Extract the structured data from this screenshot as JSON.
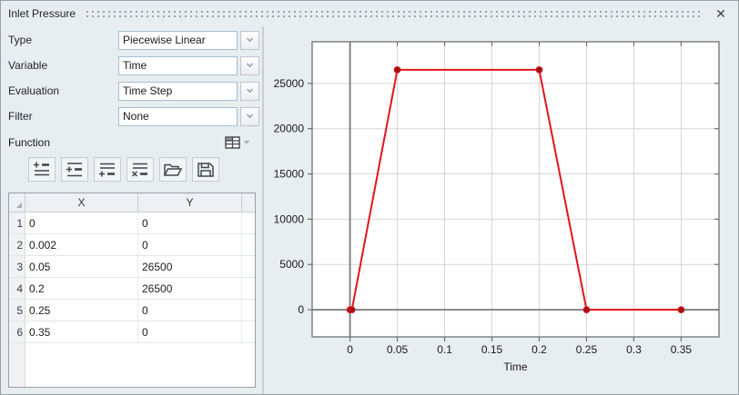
{
  "colors": {
    "panel_bg": "#e8edf0",
    "line_red": "#e1161d",
    "marker_red": "#9e1216",
    "grid_gray": "#d6d6d6",
    "plot_border": "#6e7275",
    "zero_axis": "#77797b"
  },
  "window": {
    "title": "Inlet Pressure",
    "close_glyph": "✕"
  },
  "form": {
    "fields": [
      {
        "label": "Type",
        "value": "Piecewise Linear"
      },
      {
        "label": "Variable",
        "value": "Time"
      },
      {
        "label": "Evaluation",
        "value": "Time Step"
      },
      {
        "label": "Filter",
        "value": "None"
      }
    ]
  },
  "function_section": {
    "label": "Function",
    "grid_menu_icon": "table-grid-icon",
    "toolbar_icons": [
      "insert-row-first-icon",
      "insert-row-above-icon",
      "append-row-icon",
      "delete-row-icon",
      "open-file-icon",
      "save-file-icon"
    ]
  },
  "table": {
    "columns": {
      "x": "X",
      "y": "Y"
    },
    "rows": [
      {
        "n": "1",
        "x": "0",
        "y": "0"
      },
      {
        "n": "2",
        "x": "0.002",
        "y": "0"
      },
      {
        "n": "3",
        "x": "0.05",
        "y": "26500"
      },
      {
        "n": "4",
        "x": "0.2",
        "y": "26500"
      },
      {
        "n": "5",
        "x": "0.25",
        "y": "0"
      },
      {
        "n": "6",
        "x": "0.35",
        "y": "0"
      }
    ]
  },
  "chart_data": {
    "type": "line",
    "title": "",
    "xlabel": "Time",
    "ylabel": "",
    "xlim": [
      -0.04,
      0.39
    ],
    "ylim": [
      -3000,
      29600
    ],
    "xticks": [
      0,
      0.05,
      0.1,
      0.15,
      0.2,
      0.25,
      0.3,
      0.35
    ],
    "xtick_labels": [
      "0",
      "0.05",
      "0.1",
      "0.15",
      "0.2",
      "0.25",
      "0.3",
      "0.35"
    ],
    "yticks": [
      0,
      5000,
      10000,
      15000,
      20000,
      25000
    ],
    "ytick_labels": [
      "0",
      "5000",
      "10000",
      "15000",
      "20000",
      "25000"
    ],
    "grid": true,
    "legend": false,
    "series": [
      {
        "color": "#e1161d",
        "marker_color": "#9e1216",
        "x": [
          0,
          0.002,
          0.05,
          0.2,
          0.25,
          0.35
        ],
        "y": [
          0,
          0,
          26500,
          26500,
          0,
          0
        ]
      }
    ]
  }
}
